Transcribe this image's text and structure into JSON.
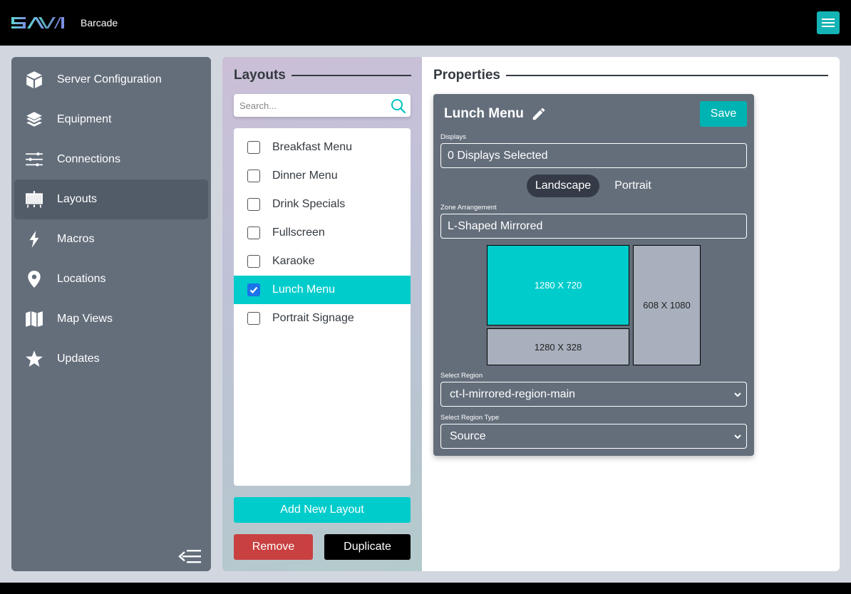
{
  "header": {
    "logo_text": "SAVi",
    "venue_name": "Barcade",
    "menu_icon": "hamburger-icon",
    "menu_color": "#14b3b5"
  },
  "sidebar": {
    "items": [
      {
        "label": "Server Configuration",
        "icon": "cube-icon",
        "active": false
      },
      {
        "label": "Equipment",
        "icon": "layers-icon",
        "active": false
      },
      {
        "label": "Connections",
        "icon": "sliders-icon",
        "active": false
      },
      {
        "label": "Layouts",
        "icon": "easel-icon",
        "active": true
      },
      {
        "label": "Macros",
        "icon": "lightning-icon",
        "active": false
      },
      {
        "label": "Locations",
        "icon": "map-pin-icon",
        "active": false
      },
      {
        "label": "Map Views",
        "icon": "map-icon",
        "active": false
      },
      {
        "label": "Updates",
        "icon": "star-icon",
        "active": false
      }
    ],
    "collapse_icon": "collapse-menu-icon"
  },
  "layouts": {
    "title": "Layouts",
    "search_placeholder": "Search...",
    "search_value": "",
    "items": [
      {
        "label": "Breakfast Menu",
        "checked": false
      },
      {
        "label": "Dinner Menu",
        "checked": false
      },
      {
        "label": "Drink Specials",
        "checked": false
      },
      {
        "label": "Fullscreen",
        "checked": false
      },
      {
        "label": "Karaoke",
        "checked": false
      },
      {
        "label": "Lunch Menu",
        "checked": true
      },
      {
        "label": "Portrait Signage",
        "checked": false
      }
    ],
    "add_label": "Add New Layout",
    "remove_label": "Remove",
    "duplicate_label": "Duplicate",
    "colors": {
      "accent": "#00cccc",
      "danger": "#c94040",
      "dark": "#000000"
    }
  },
  "properties": {
    "title": "Properties",
    "layout_name": "Lunch Menu",
    "save_label": "Save",
    "displays_label": "Displays",
    "displays_value": "0 Displays Selected",
    "orientation": {
      "options": [
        "Landscape",
        "Portrait"
      ],
      "selected": "Landscape"
    },
    "zone_label": "Zone Arrangement",
    "zone_value": "L-Shaped Mirrored",
    "zones": [
      {
        "label": "1280 X 720",
        "active": true
      },
      {
        "label": "1280 X 328",
        "active": false
      },
      {
        "label": "608 X 1080",
        "active": false
      }
    ],
    "region_label": "Select Region",
    "region_value": "ct-l-mirrored-region-main",
    "region_type_label": "Select Region Type",
    "region_type_value": "Source"
  }
}
